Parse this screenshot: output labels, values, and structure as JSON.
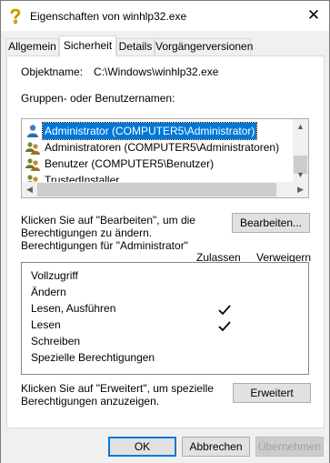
{
  "window": {
    "title": "Eigenschaften von winhlp32.exe",
    "close_glyph": "✕"
  },
  "tabs": [
    {
      "label": "Allgemein",
      "active": false
    },
    {
      "label": "Sicherheit",
      "active": true
    },
    {
      "label": "Details",
      "active": false
    },
    {
      "label": "Vorgängerversionen",
      "active": false
    }
  ],
  "object": {
    "label": "Objektname:",
    "value": "C:\\Windows\\winhlp32.exe"
  },
  "groups": {
    "label": "Gruppen- oder Benutzernamen:",
    "items": [
      {
        "name": "Administrator (COMPUTER5\\Administrator)",
        "selected": true,
        "icon": "single-user-icon"
      },
      {
        "name": "Administratoren (COMPUTER5\\Administratoren)",
        "selected": false,
        "icon": "user-group-icon"
      },
      {
        "name": "Benutzer (COMPUTER5\\Benutzer)",
        "selected": false,
        "icon": "user-group-icon"
      },
      {
        "name": "TrustedInstaller",
        "selected": false,
        "icon": "user-group-icon"
      }
    ]
  },
  "edit": {
    "hint_line1": "Klicken Sie auf \"Bearbeiten\", um die",
    "hint_line2": "Berechtigungen zu ändern.",
    "button": "Bearbeiten...",
    "button_accel": "a"
  },
  "permissions": {
    "header": "Berechtigungen für \"Administrator\"",
    "col_allow": "Zulassen",
    "col_deny": "Verweigern",
    "rows": [
      {
        "name": "Vollzugriff",
        "allow": false,
        "deny": false
      },
      {
        "name": "Ändern",
        "allow": false,
        "deny": false
      },
      {
        "name": "Lesen, Ausführen",
        "allow": true,
        "deny": false
      },
      {
        "name": "Lesen",
        "allow": true,
        "deny": false
      },
      {
        "name": "Schreiben",
        "allow": false,
        "deny": false
      },
      {
        "name": "Spezielle Berechtigungen",
        "allow": false,
        "deny": false
      }
    ]
  },
  "advanced": {
    "hint_line1": "Klicken Sie auf \"Erweitert\", um spezielle",
    "hint_line2": "Berechtigungen anzuzeigen.",
    "button": "Erweitert"
  },
  "footer": {
    "ok": "OK",
    "cancel": "Abbrechen",
    "apply": "Übernehmen"
  }
}
